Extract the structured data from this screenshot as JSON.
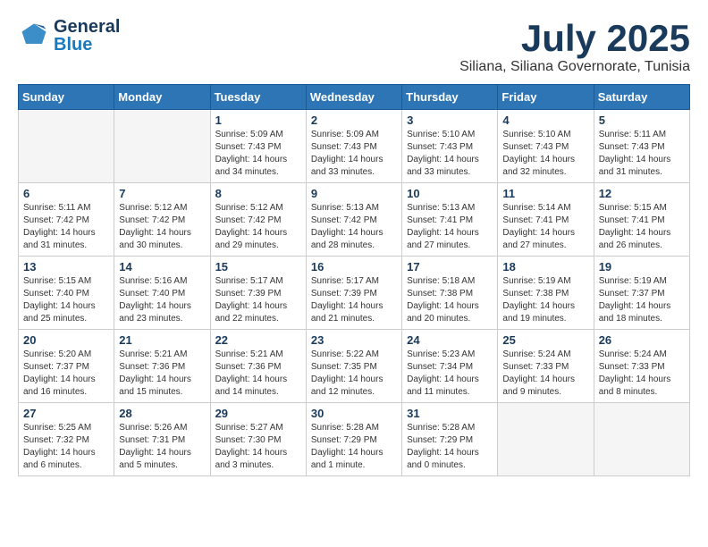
{
  "header": {
    "logo_general": "General",
    "logo_blue": "Blue",
    "month_title": "July 2025",
    "subtitle": "Siliana, Siliana Governorate, Tunisia"
  },
  "weekdays": [
    "Sunday",
    "Monday",
    "Tuesday",
    "Wednesday",
    "Thursday",
    "Friday",
    "Saturday"
  ],
  "weeks": [
    [
      {
        "day": "",
        "info": ""
      },
      {
        "day": "",
        "info": ""
      },
      {
        "day": "1",
        "info": "Sunrise: 5:09 AM\nSunset: 7:43 PM\nDaylight: 14 hours and 34 minutes."
      },
      {
        "day": "2",
        "info": "Sunrise: 5:09 AM\nSunset: 7:43 PM\nDaylight: 14 hours and 33 minutes."
      },
      {
        "day": "3",
        "info": "Sunrise: 5:10 AM\nSunset: 7:43 PM\nDaylight: 14 hours and 33 minutes."
      },
      {
        "day": "4",
        "info": "Sunrise: 5:10 AM\nSunset: 7:43 PM\nDaylight: 14 hours and 32 minutes."
      },
      {
        "day": "5",
        "info": "Sunrise: 5:11 AM\nSunset: 7:43 PM\nDaylight: 14 hours and 31 minutes."
      }
    ],
    [
      {
        "day": "6",
        "info": "Sunrise: 5:11 AM\nSunset: 7:42 PM\nDaylight: 14 hours and 31 minutes."
      },
      {
        "day": "7",
        "info": "Sunrise: 5:12 AM\nSunset: 7:42 PM\nDaylight: 14 hours and 30 minutes."
      },
      {
        "day": "8",
        "info": "Sunrise: 5:12 AM\nSunset: 7:42 PM\nDaylight: 14 hours and 29 minutes."
      },
      {
        "day": "9",
        "info": "Sunrise: 5:13 AM\nSunset: 7:42 PM\nDaylight: 14 hours and 28 minutes."
      },
      {
        "day": "10",
        "info": "Sunrise: 5:13 AM\nSunset: 7:41 PM\nDaylight: 14 hours and 27 minutes."
      },
      {
        "day": "11",
        "info": "Sunrise: 5:14 AM\nSunset: 7:41 PM\nDaylight: 14 hours and 27 minutes."
      },
      {
        "day": "12",
        "info": "Sunrise: 5:15 AM\nSunset: 7:41 PM\nDaylight: 14 hours and 26 minutes."
      }
    ],
    [
      {
        "day": "13",
        "info": "Sunrise: 5:15 AM\nSunset: 7:40 PM\nDaylight: 14 hours and 25 minutes."
      },
      {
        "day": "14",
        "info": "Sunrise: 5:16 AM\nSunset: 7:40 PM\nDaylight: 14 hours and 23 minutes."
      },
      {
        "day": "15",
        "info": "Sunrise: 5:17 AM\nSunset: 7:39 PM\nDaylight: 14 hours and 22 minutes."
      },
      {
        "day": "16",
        "info": "Sunrise: 5:17 AM\nSunset: 7:39 PM\nDaylight: 14 hours and 21 minutes."
      },
      {
        "day": "17",
        "info": "Sunrise: 5:18 AM\nSunset: 7:38 PM\nDaylight: 14 hours and 20 minutes."
      },
      {
        "day": "18",
        "info": "Sunrise: 5:19 AM\nSunset: 7:38 PM\nDaylight: 14 hours and 19 minutes."
      },
      {
        "day": "19",
        "info": "Sunrise: 5:19 AM\nSunset: 7:37 PM\nDaylight: 14 hours and 18 minutes."
      }
    ],
    [
      {
        "day": "20",
        "info": "Sunrise: 5:20 AM\nSunset: 7:37 PM\nDaylight: 14 hours and 16 minutes."
      },
      {
        "day": "21",
        "info": "Sunrise: 5:21 AM\nSunset: 7:36 PM\nDaylight: 14 hours and 15 minutes."
      },
      {
        "day": "22",
        "info": "Sunrise: 5:21 AM\nSunset: 7:36 PM\nDaylight: 14 hours and 14 minutes."
      },
      {
        "day": "23",
        "info": "Sunrise: 5:22 AM\nSunset: 7:35 PM\nDaylight: 14 hours and 12 minutes."
      },
      {
        "day": "24",
        "info": "Sunrise: 5:23 AM\nSunset: 7:34 PM\nDaylight: 14 hours and 11 minutes."
      },
      {
        "day": "25",
        "info": "Sunrise: 5:24 AM\nSunset: 7:33 PM\nDaylight: 14 hours and 9 minutes."
      },
      {
        "day": "26",
        "info": "Sunrise: 5:24 AM\nSunset: 7:33 PM\nDaylight: 14 hours and 8 minutes."
      }
    ],
    [
      {
        "day": "27",
        "info": "Sunrise: 5:25 AM\nSunset: 7:32 PM\nDaylight: 14 hours and 6 minutes."
      },
      {
        "day": "28",
        "info": "Sunrise: 5:26 AM\nSunset: 7:31 PM\nDaylight: 14 hours and 5 minutes."
      },
      {
        "day": "29",
        "info": "Sunrise: 5:27 AM\nSunset: 7:30 PM\nDaylight: 14 hours and 3 minutes."
      },
      {
        "day": "30",
        "info": "Sunrise: 5:28 AM\nSunset: 7:29 PM\nDaylight: 14 hours and 1 minute."
      },
      {
        "day": "31",
        "info": "Sunrise: 5:28 AM\nSunset: 7:29 PM\nDaylight: 14 hours and 0 minutes."
      },
      {
        "day": "",
        "info": ""
      },
      {
        "day": "",
        "info": ""
      }
    ]
  ]
}
